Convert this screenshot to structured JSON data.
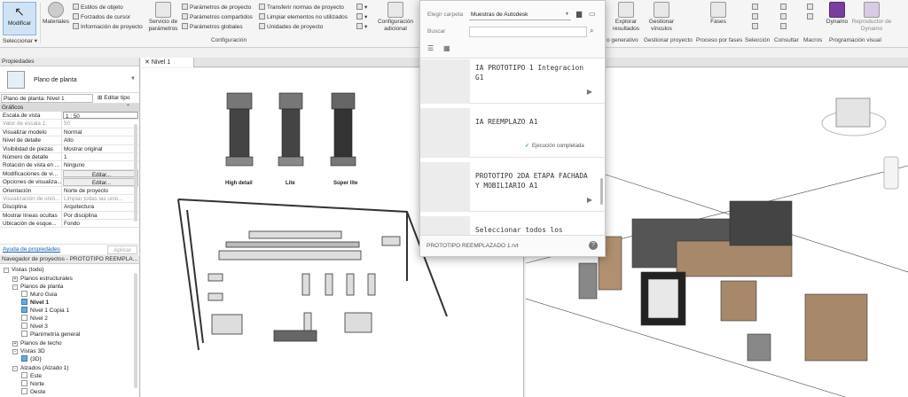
{
  "ribbon": {
    "modificar": "Modificar",
    "seleccionar": "Seleccionar ▾",
    "materiales": "Materiales",
    "estilos_objeto": "Estilos de objeto",
    "forzados_cursor": "Forzados de cursor",
    "info_proyecto": "Información de proyecto",
    "servicio_parametros": "Servicio de parámetros",
    "param_proyecto": "Parámetros de proyecto",
    "param_compartidos": "Parámetros compartidos",
    "param_globales": "Parámetros globales",
    "transferir_normas": "Transferir normas de proyecto",
    "limpiar_elementos": "Limpiar elementos no utilizados",
    "unidades_proyecto": "Unidades de proyecto",
    "config_adicional": "Configuración adicional",
    "panel_configuracion": "Configuración",
    "explorar_resultados": "Explorar resultados",
    "gestionar_vinculos": "Gestionar vínculos",
    "fases": "Fases",
    "panel_generativo": "o generativo",
    "panel_gestionar": "Gestionar proyecto",
    "panel_fases": "Proceso por fases",
    "panel_seleccion": "Selección",
    "panel_consultar": "Consultar",
    "panel_macros": "Macros",
    "dynamo": "Dynamo",
    "reproductor_dynamo": "Reproductor de Dynamo",
    "panel_visual": "Programación visual"
  },
  "properties": {
    "title": "Propiedades",
    "type_name": "Plano de planta",
    "instance_selector": "Plano de planta: Nivel 1",
    "edit_type": "Editar tipo",
    "group": "Gráficos",
    "rows": [
      {
        "k": "Escala de vista",
        "v": "1 : 50"
      },
      {
        "k": "Valor de escala    1:",
        "v": "50"
      },
      {
        "k": "Visualizar modelo",
        "v": "Normal"
      },
      {
        "k": "Nivel de detalle",
        "v": "Alto"
      },
      {
        "k": "Visibilidad de piezas",
        "v": "Mostrar original"
      },
      {
        "k": "Número de detalle",
        "v": "1"
      },
      {
        "k": "Rotación de vista en ...",
        "v": "Ninguno"
      },
      {
        "k": "Modificaciones de vi...",
        "v": "Editar..."
      },
      {
        "k": "Opciones de visualiza...",
        "v": "Editar..."
      },
      {
        "k": "Orientación",
        "v": "Norte de proyecto"
      },
      {
        "k": "Visualización de unió...",
        "v": "Limpiar todas las unio..."
      },
      {
        "k": "Disciplina",
        "v": "Arquitectura"
      },
      {
        "k": "Mostrar líneas ocultas",
        "v": "Por disciplina"
      },
      {
        "k": "Ubicación de esque...",
        "v": "Fondo"
      }
    ],
    "help_link": "Ayuda de propiedades",
    "apply": "Aplicar"
  },
  "navigator": {
    "title": "Navegador de proyectos - PROTOTIPO REEMPLA...",
    "items": [
      "Vistas (todo)",
      "Planos estructurales",
      "Planos de planta",
      "Muro Guia",
      "Nivel 1",
      "Nivel 1 Copia 1",
      "Nivel 2",
      "Nivel 3",
      "Planimetría general",
      "Planos de techo",
      "Vistas 3D",
      "{3D}",
      "Alzados (Alzado 1)",
      "Este",
      "Norte",
      "Oeste"
    ]
  },
  "view_tab": "Nivel 1",
  "samples": [
    "High detail",
    "Lite",
    "Súper lite"
  ],
  "dialog": {
    "folder_label": "Elegir carpeta",
    "folder_value": "Muestras de Autodesk",
    "search_label": "Buscar",
    "cards": [
      {
        "title": "IA PROTOTIPO 1 Integracion G1",
        "status": ""
      },
      {
        "title": "IA REEMPLAZO A1",
        "status": "Ejecución completada"
      },
      {
        "title": "PROTOTIPO 2DA ETAPA FACHADA Y MOBILIARIO A1",
        "status": ""
      },
      {
        "title": "Seleccionar todos los elementos",
        "status": ""
      }
    ],
    "footer_file": "PROTOTIPO REEMPLAZADO 1.rvt",
    "help": "?"
  },
  "colors": {
    "accent": "#1a5fb4",
    "ok": "#2e9e3e",
    "selected_bg": "#cfe3f5"
  }
}
